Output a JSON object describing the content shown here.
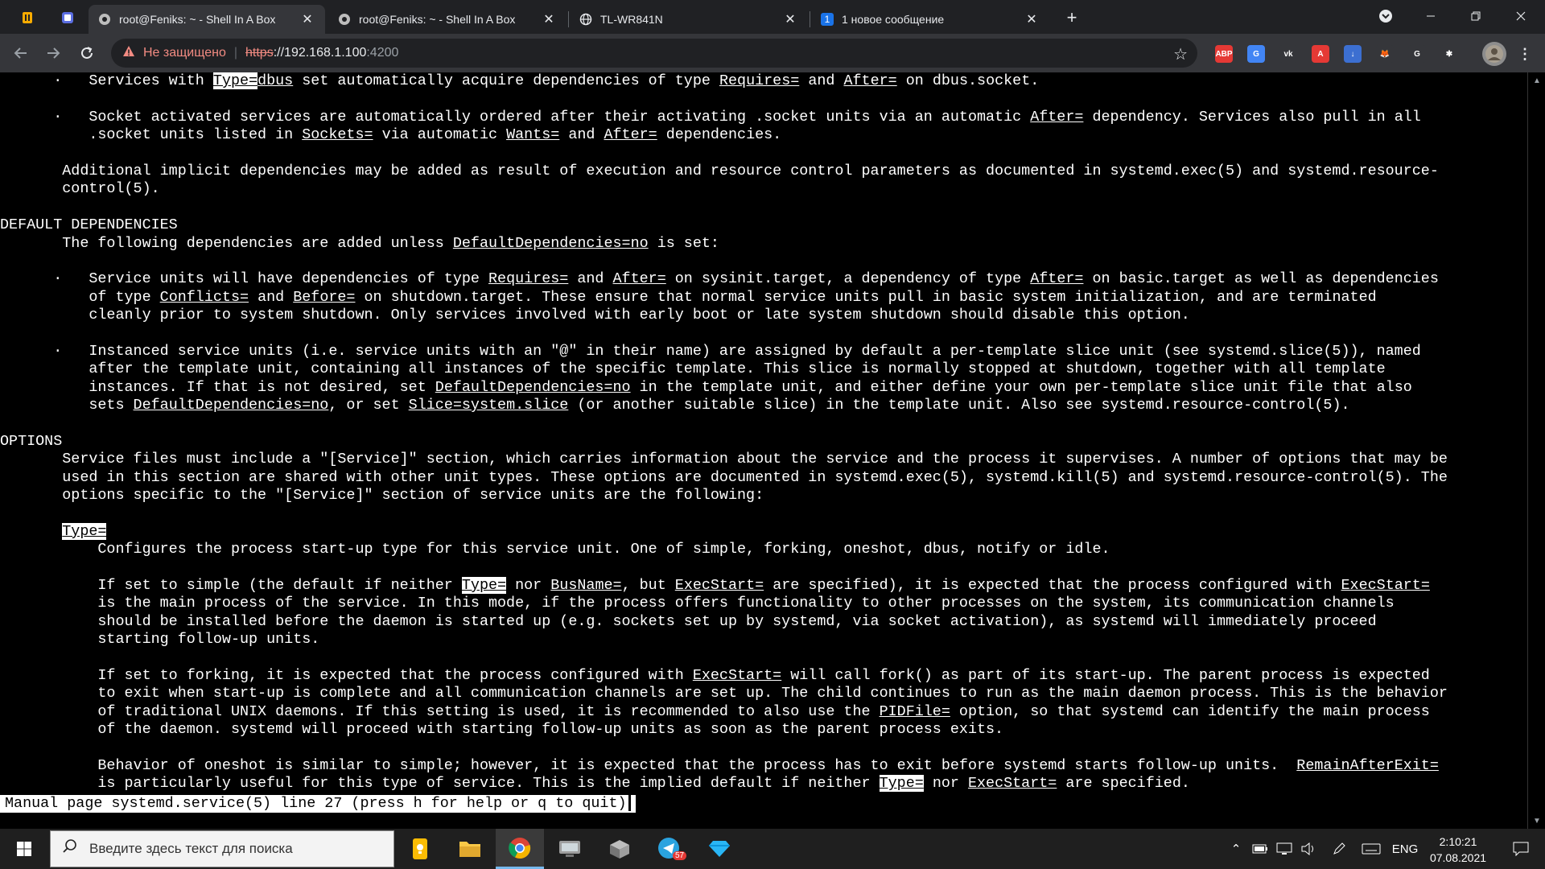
{
  "browser": {
    "tabs": [
      {
        "title": "root@Feniks: ~ - Shell In A Box",
        "active": true
      },
      {
        "title": "root@Feniks: ~ - Shell In A Box",
        "active": false
      },
      {
        "title": "TL-WR841N",
        "active": false
      },
      {
        "title": "1 новое сообщение",
        "active": false,
        "badge": "1"
      }
    ],
    "close_glyph": "✕",
    "new_tab_glyph": "+",
    "omnibox": {
      "security_label": "Не защищено",
      "url_scheme": "https",
      "url_host": "://192.168.1.100",
      "url_port": ":4200"
    },
    "extensions": [
      {
        "name": "adblock-icon",
        "label": "ABP",
        "color": "#e53935"
      },
      {
        "name": "translate-icon",
        "label": "G",
        "color": "#4285f4"
      },
      {
        "name": "vk-icon",
        "label": "vk",
        "color": "#35363a"
      },
      {
        "name": "a-icon",
        "label": "A",
        "color": "#e53935"
      },
      {
        "name": "download-icon",
        "label": "↓",
        "color": "#3c6fd1"
      },
      {
        "name": "fox-icon",
        "label": "🦊",
        "color": "#35363a"
      },
      {
        "name": "google-icon",
        "label": "G",
        "color": "#35363a"
      },
      {
        "name": "puzzle-icon",
        "label": "✱",
        "color": "#35363a"
      }
    ]
  },
  "terminal": {
    "lines": [
      [
        {
          "t": "      ·   Services with "
        },
        {
          "t": "Type=",
          "s": "inv"
        },
        {
          "t": "dbus",
          "s": "u"
        },
        {
          "t": " set automatically acquire dependencies of type "
        },
        {
          "t": "Requires=",
          "s": "u"
        },
        {
          "t": " and "
        },
        {
          "t": "After=",
          "s": "u"
        },
        {
          "t": " on dbus.socket."
        }
      ],
      [],
      [
        {
          "t": "      ·   Socket activated services are automatically ordered after their activating .socket units via an automatic "
        },
        {
          "t": "After=",
          "s": "u"
        },
        {
          "t": " dependency. Services also pull in all"
        }
      ],
      [
        {
          "t": "          .socket units listed in "
        },
        {
          "t": "Sockets=",
          "s": "u"
        },
        {
          "t": " via automatic "
        },
        {
          "t": "Wants=",
          "s": "u"
        },
        {
          "t": " and "
        },
        {
          "t": "After=",
          "s": "u"
        },
        {
          "t": " dependencies."
        }
      ],
      [],
      [
        {
          "t": "       Additional implicit dependencies may be added as result of execution and resource control parameters as documented in systemd.exec(5) and systemd.resource-"
        }
      ],
      [
        {
          "t": "       control(5)."
        }
      ],
      [],
      [
        {
          "t": "DEFAULT DEPENDENCIES"
        }
      ],
      [
        {
          "t": "       The following dependencies are added unless "
        },
        {
          "t": "DefaultDependencies=no",
          "s": "u"
        },
        {
          "t": " is set:"
        }
      ],
      [],
      [
        {
          "t": "      ·   Service units will have dependencies of type "
        },
        {
          "t": "Requires=",
          "s": "u"
        },
        {
          "t": " and "
        },
        {
          "t": "After=",
          "s": "u"
        },
        {
          "t": " on sysinit.target, a dependency of type "
        },
        {
          "t": "After=",
          "s": "u"
        },
        {
          "t": " on basic.target as well as dependencies"
        }
      ],
      [
        {
          "t": "          of type "
        },
        {
          "t": "Conflicts=",
          "s": "u"
        },
        {
          "t": " and "
        },
        {
          "t": "Before=",
          "s": "u"
        },
        {
          "t": " on shutdown.target. These ensure that normal service units pull in basic system initialization, and are terminated"
        }
      ],
      [
        {
          "t": "          cleanly prior to system shutdown. Only services involved with early boot or late system shutdown should disable this option."
        }
      ],
      [],
      [
        {
          "t": "      ·   Instanced service units (i.e. service units with an \"@\" in their name) are assigned by default a per-template slice unit (see systemd.slice(5)), named"
        }
      ],
      [
        {
          "t": "          after the template unit, containing all instances of the specific template. This slice is normally stopped at shutdown, together with all template"
        }
      ],
      [
        {
          "t": "          instances. If that is not desired, set "
        },
        {
          "t": "DefaultDependencies=no",
          "s": "u"
        },
        {
          "t": " in the template unit, and either define your own per-template slice unit file that also"
        }
      ],
      [
        {
          "t": "          sets "
        },
        {
          "t": "DefaultDependencies=no",
          "s": "u"
        },
        {
          "t": ", or set "
        },
        {
          "t": "Slice=system.slice",
          "s": "u"
        },
        {
          "t": " (or another suitable slice) in the template unit. Also see systemd.resource-control(5)."
        }
      ],
      [],
      [
        {
          "t": "OPTIONS"
        }
      ],
      [
        {
          "t": "       Service files must include a \"[Service]\" section, which carries information about the service and the process it supervises. A number of options that may be"
        }
      ],
      [
        {
          "t": "       used in this section are shared with other unit types. These options are documented in systemd.exec(5), systemd.kill(5) and systemd.resource-control(5). The"
        }
      ],
      [
        {
          "t": "       options specific to the \"[Service]\" section of service units are the following:"
        }
      ],
      [],
      [
        {
          "t": "       "
        },
        {
          "t": "Type=",
          "s": "inv"
        }
      ],
      [
        {
          "t": "           Configures the process start-up type for this service unit. One of simple, forking, oneshot, dbus, notify or idle."
        }
      ],
      [],
      [
        {
          "t": "           If set to simple (the default if neither "
        },
        {
          "t": "Type=",
          "s": "inv"
        },
        {
          "t": " nor "
        },
        {
          "t": "BusName=",
          "s": "u"
        },
        {
          "t": ", but "
        },
        {
          "t": "ExecStart=",
          "s": "u"
        },
        {
          "t": " are specified), it is expected that the process configured with "
        },
        {
          "t": "ExecStart=",
          "s": "u"
        }
      ],
      [
        {
          "t": "           is the main process of the service. In this mode, if the process offers functionality to other processes on the system, its communication channels"
        }
      ],
      [
        {
          "t": "           should be installed before the daemon is started up (e.g. sockets set up by systemd, via socket activation), as systemd will immediately proceed"
        }
      ],
      [
        {
          "t": "           starting follow-up units."
        }
      ],
      [],
      [
        {
          "t": "           If set to forking, it is expected that the process configured with "
        },
        {
          "t": "ExecStart=",
          "s": "u"
        },
        {
          "t": " will call fork() as part of its start-up. The parent process is expected"
        }
      ],
      [
        {
          "t": "           to exit when start-up is complete and all communication channels are set up. The child continues to run as the main daemon process. This is the behavior"
        }
      ],
      [
        {
          "t": "           of traditional UNIX daemons. If this setting is used, it is recommended to also use the "
        },
        {
          "t": "PIDFile=",
          "s": "u"
        },
        {
          "t": " option, so that systemd can identify the main process"
        }
      ],
      [
        {
          "t": "           of the daemon. systemd will proceed with starting follow-up units as soon as the parent process exits."
        }
      ],
      [],
      [
        {
          "t": "           Behavior of oneshot is similar to simple; however, it is expected that the process has to exit before systemd starts follow-up units.  "
        },
        {
          "t": "RemainAfterExit=",
          "s": "u"
        }
      ],
      [
        {
          "t": "           is particularly useful for this type of service. This is the implied default if neither "
        },
        {
          "t": "Type=",
          "s": "inv"
        },
        {
          "t": " nor "
        },
        {
          "t": "ExecStart=",
          "s": "u"
        },
        {
          "t": " are specified."
        }
      ]
    ],
    "status": "Manual page systemd.service(5) line 27 (press h for help or q to quit)"
  },
  "taskbar": {
    "search_placeholder": "Введите здесь текст для поиска",
    "telegram_badge": "57",
    "language": "ENG",
    "time": "2:10:21",
    "date": "07.08.2021"
  }
}
